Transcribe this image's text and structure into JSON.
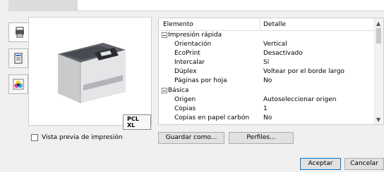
{
  "preview": {
    "badge": "PCL XL",
    "checkbox_label": "Vista previa de impresión"
  },
  "grid": {
    "col_element": "Elemento",
    "col_detail": "Detalle",
    "groups": [
      {
        "name": "Impresión rápida",
        "rows": [
          {
            "name": "Orientación",
            "value": "Vertical"
          },
          {
            "name": "EcoPrint",
            "value": "Desactivado"
          },
          {
            "name": "Intercalar",
            "value": "Sí"
          },
          {
            "name": "Dúplex",
            "value": "Voltear por el borde largo"
          },
          {
            "name": "Páginas por hoja",
            "value": "No"
          }
        ]
      },
      {
        "name": "Básica",
        "rows": [
          {
            "name": "Origen",
            "value": "Autoseleccionar origen"
          },
          {
            "name": "Copias",
            "value": "1"
          },
          {
            "name": "Copias en papel carbón",
            "value": "No"
          }
        ]
      }
    ]
  },
  "buttons": {
    "save_as": "Guardar como...",
    "profiles": "Perfiles...",
    "accept": "Aceptar",
    "cancel": "Cancelar"
  },
  "colors": {
    "accent_border": "#0078d7"
  }
}
